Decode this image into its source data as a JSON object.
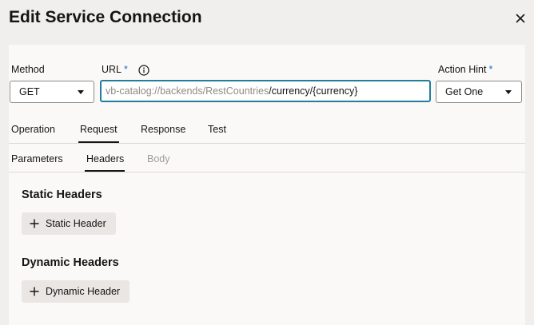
{
  "dialog": {
    "title": "Edit Service Connection",
    "close_icon": "close-icon"
  },
  "form": {
    "method": {
      "label": "Method",
      "value": "GET"
    },
    "url": {
      "label": "URL",
      "required_mark": "*",
      "prefix": "vb-catalog://backends/RestCountries",
      "suffix": "/currency/{currency}",
      "info_icon": "info-icon"
    },
    "action_hint": {
      "label": "Action Hint",
      "required_mark": "*",
      "value": "Get One"
    }
  },
  "tabs": [
    {
      "label": "Operation"
    },
    {
      "label": "Request",
      "active": true
    },
    {
      "label": "Response"
    },
    {
      "label": "Test"
    }
  ],
  "subtabs": [
    {
      "label": "Parameters"
    },
    {
      "label": "Headers",
      "active": true
    },
    {
      "label": "Body",
      "disabled": true
    }
  ],
  "static_headers": {
    "title": "Static Headers",
    "add_label": "Static Header"
  },
  "dynamic_headers": {
    "title": "Dynamic Headers",
    "add_label": "Dynamic Header"
  },
  "colors": {
    "header_bg": "#f1efed",
    "panel_bg": "#fbf9f8",
    "focus_border": "#227e9e",
    "required": "#1a73c8"
  }
}
